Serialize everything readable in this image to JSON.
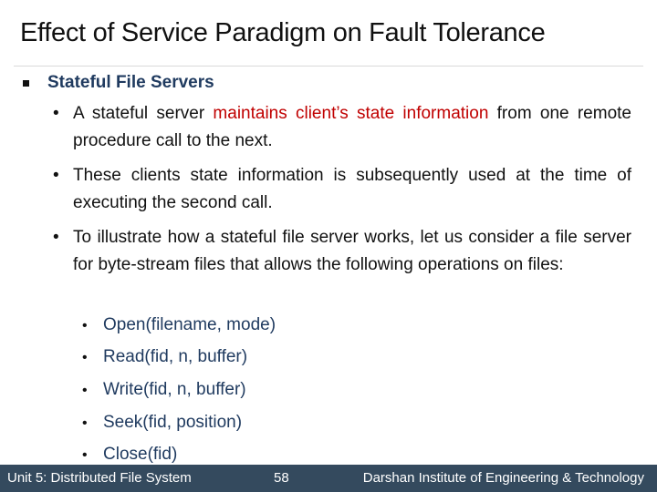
{
  "slide": {
    "title": "Effect of Service Paradigm on Fault Tolerance",
    "heading": "Stateful File Servers",
    "bullets": [
      {
        "before": "A stateful server ",
        "highlight": "maintains client’s state information",
        "after": " from one remote procedure call to the next."
      },
      {
        "text": "These clients state information is subsequently used at the time of executing the second call."
      },
      {
        "text": "To illustrate how a stateful file server works, let us consider a file server for byte-stream files that allows the following operations on files:"
      }
    ],
    "operations": [
      "Open(filename, mode)",
      "Read(fid, n, buffer)",
      "Write(fid, n, buffer)",
      "Seek(fid, position)",
      "Close(fid)"
    ],
    "bullet_glyph": "•",
    "highlight_color": "#c00000",
    "heading_color": "#1f3a5f"
  },
  "footer": {
    "unit": "Unit 5: Distributed File System",
    "page_number": "58",
    "institute": "Darshan Institute of Engineering & Technology",
    "background": "#344a5e"
  }
}
